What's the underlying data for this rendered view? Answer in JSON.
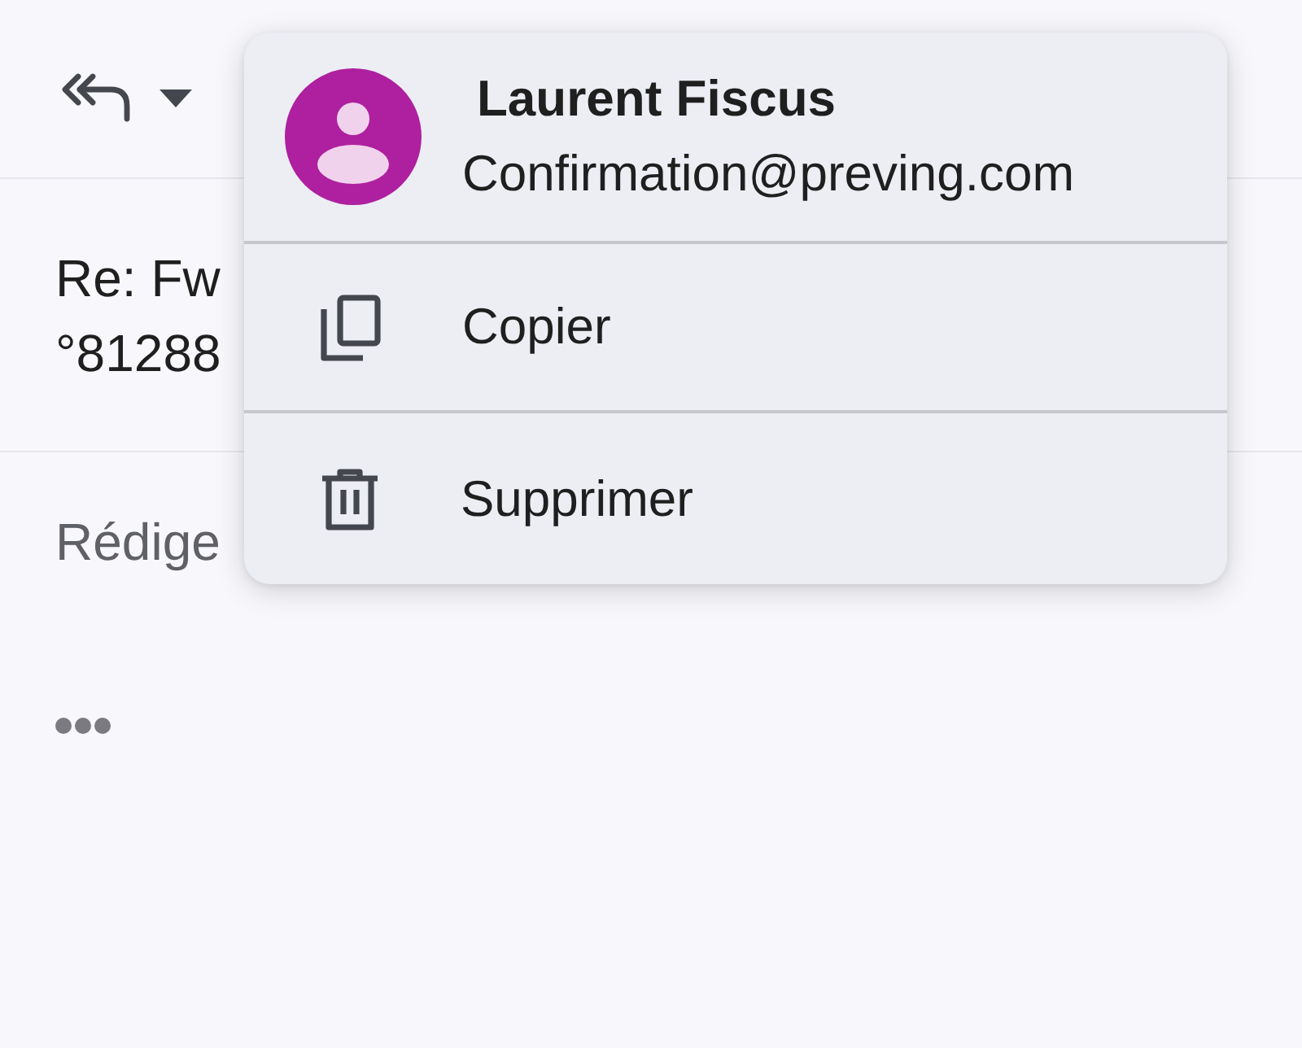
{
  "subject": {
    "lines": [
      "Re: Fw",
      "°81288"
    ]
  },
  "compose": {
    "placeholder": "Rédige"
  },
  "menu": {
    "contact": {
      "name": "Laurent Fiscus",
      "email": "Confirmation@preving.com"
    },
    "items": [
      {
        "kind": "copy",
        "label": "Copier"
      },
      {
        "kind": "delete",
        "label": "Supprimer"
      }
    ]
  }
}
